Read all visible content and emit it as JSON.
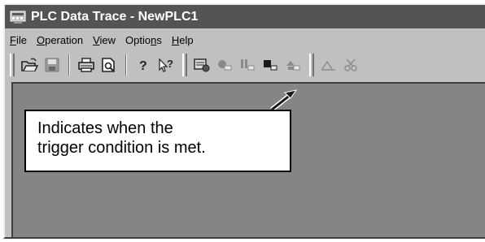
{
  "window": {
    "title": "PLC Data Trace - NewPLC1"
  },
  "menu": [
    {
      "label": "File",
      "mnemonic": "F",
      "rest": "ile"
    },
    {
      "label": "Operation",
      "mnemonic": "O",
      "rest": "peration"
    },
    {
      "label": "View",
      "mnemonic": "V",
      "rest": "iew"
    },
    {
      "label": "Options",
      "pre": "Optio",
      "mnemonic": "n",
      "rest": "s"
    },
    {
      "label": "Help",
      "mnemonic": "H",
      "rest": "elp"
    }
  ],
  "toolbar": {
    "icons": [
      "open-icon",
      "save-icon",
      "print-icon",
      "print-preview-icon",
      "help-icon",
      "context-help-icon",
      "trace-settings-icon",
      "trigger-indicator-icon",
      "stop-icon",
      "record-icon",
      "transfer-icon",
      "chart-icon",
      "cut-icon"
    ]
  },
  "callout": {
    "line1": "Indicates when the",
    "line2": "trigger condition is met."
  }
}
